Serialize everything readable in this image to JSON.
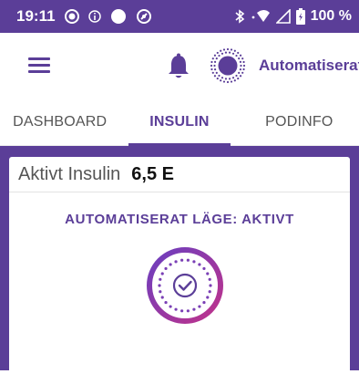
{
  "status_bar": {
    "time": "19:11",
    "battery": "100 %",
    "icons": [
      "record-icon",
      "info-icon",
      "dot-icon",
      "at-icon",
      "bluetooth-icon",
      "wifi-icon",
      "signal-icon",
      "battery-icon"
    ]
  },
  "app_bar": {
    "mode_label": "Automatiserat",
    "icons": [
      "menu-icon",
      "bell-icon",
      "automated-mode-icon"
    ]
  },
  "tabs": [
    {
      "label": "DASHBOARD",
      "active": false
    },
    {
      "label": "INSULIN",
      "active": true
    },
    {
      "label": "PODINFO",
      "active": false
    }
  ],
  "card": {
    "insulin_label": "Aktivt Insulin",
    "insulin_value": "6,5 E",
    "mode_status": "AUTOMATISERAT LÄGE: AKTIVT"
  },
  "colors": {
    "primary": "#5b3e98",
    "gradient_start": "#6a3fc0",
    "gradient_end": "#c0328a"
  }
}
